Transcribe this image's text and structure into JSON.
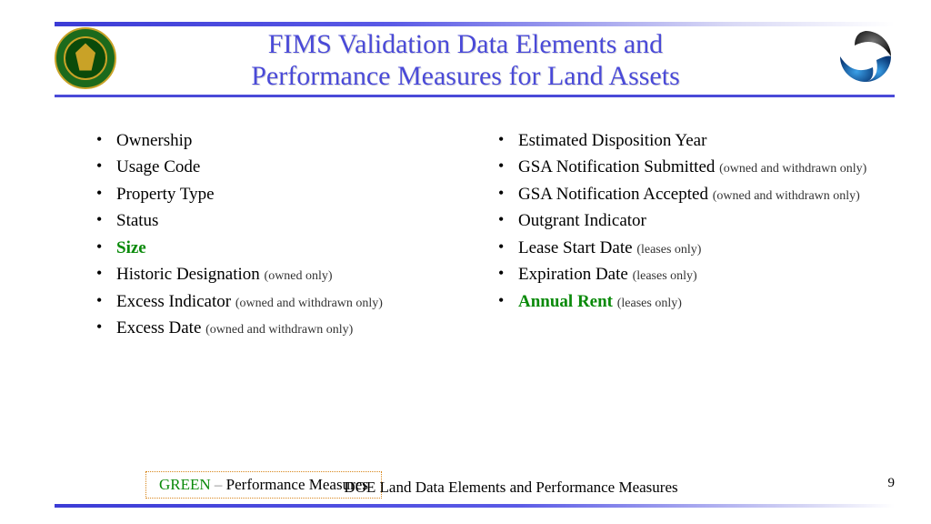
{
  "header": {
    "title_line1": "FIMS Validation Data Elements and",
    "title_line2": "Performance Measures for Land Assets"
  },
  "columns": {
    "left": [
      {
        "label": "Ownership",
        "qualifier": "",
        "highlight": false
      },
      {
        "label": "Usage Code",
        "qualifier": "",
        "highlight": false
      },
      {
        "label": "Property Type",
        "qualifier": "",
        "highlight": false
      },
      {
        "label": "Status",
        "qualifier": "",
        "highlight": false
      },
      {
        "label": "Size",
        "qualifier": "",
        "highlight": true
      },
      {
        "label": "Historic Designation",
        "qualifier": "(owned only)",
        "highlight": false
      },
      {
        "label": "Excess Indicator",
        "qualifier": "(owned and withdrawn only)",
        "highlight": false
      },
      {
        "label": "Excess Date",
        "qualifier": "(owned and withdrawn only)",
        "highlight": false
      }
    ],
    "right": [
      {
        "label": "Estimated Disposition Year",
        "qualifier": "",
        "highlight": false
      },
      {
        "label": "GSA Notification Submitted",
        "qualifier": "(owned and withdrawn only)",
        "highlight": false
      },
      {
        "label": "GSA Notification Accepted",
        "qualifier": "(owned and withdrawn only)",
        "highlight": false
      },
      {
        "label": "Outgrant Indicator",
        "qualifier": "",
        "highlight": false
      },
      {
        "label": "Lease Start Date",
        "qualifier": "(leases only)",
        "highlight": false
      },
      {
        "label": "Expiration Date",
        "qualifier": "(leases only)",
        "highlight": false
      },
      {
        "label": "Annual Rent",
        "qualifier": "(leases only)",
        "highlight": true
      }
    ]
  },
  "legend": {
    "green_word": "GREEN",
    "dash": " – ",
    "rest": "Performance Measures"
  },
  "footer": {
    "center_text": "DOE Land Data Elements and Performance Measures",
    "page_number": "9"
  }
}
